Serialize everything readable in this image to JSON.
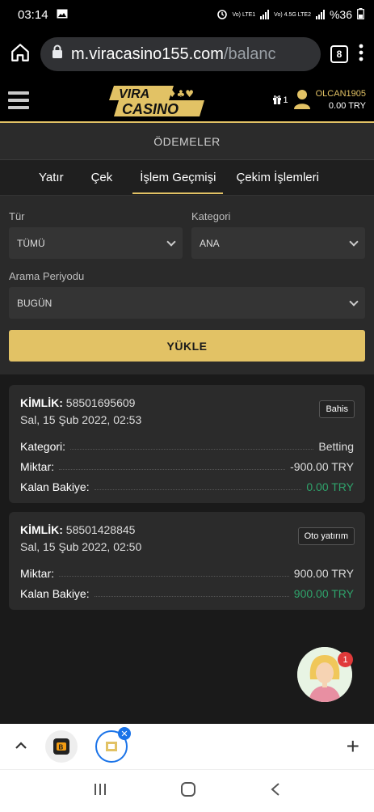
{
  "status": {
    "time": "03:14",
    "battery": "%36",
    "net1": "Vo) LTE1",
    "net2": "Vo) 4.5G LTE2"
  },
  "browser": {
    "url_main": "m.viracasino155.com",
    "url_dim": "/balanc",
    "tab_count": "8"
  },
  "header": {
    "logo_top": "VIRA",
    "logo_bottom": "CASINO",
    "gift_count": "1",
    "username": "OLCAN1905",
    "balance": "0.00 TRY"
  },
  "page": {
    "title": "ÖDEMELER"
  },
  "tabs": [
    "Yatır",
    "Çek",
    "İşlem Geçmişi",
    "Çekim İşlemleri"
  ],
  "filters": {
    "type_label": "Tür",
    "type_value": "TÜMÜ",
    "category_label": "Kategori",
    "category_value": "ANA",
    "period_label": "Arama Periyodu",
    "period_value": "BUGÜN",
    "load_button": "YÜKLE"
  },
  "transactions": [
    {
      "id_label": "KİMLİK:",
      "id": "58501695609",
      "date": "Sal, 15 Şub 2022, 02:53",
      "tag": "Bahis",
      "category_label": "Kategori:",
      "category": "Betting",
      "amount_label": "Miktar:",
      "amount": "-900.00 TRY",
      "balance_label": "Kalan Bakiye:",
      "balance": "0.00 TRY"
    },
    {
      "id_label": "KİMLİK:",
      "id": "58501428845",
      "date": "Sal, 15 Şub 2022, 02:50",
      "tag": "Oto yatırım",
      "amount_label": "Miktar:",
      "amount": "900.00 TRY",
      "balance_label": "Kalan Bakiye:",
      "balance": "900.00 TRY"
    }
  ],
  "chat": {
    "badge": "1"
  },
  "colors": {
    "accent": "#e2c265",
    "positive": "#2fa36b",
    "chrome_blue": "#1a73e8"
  }
}
